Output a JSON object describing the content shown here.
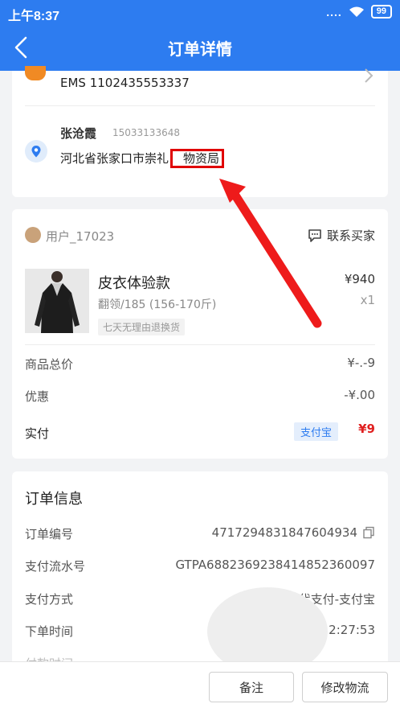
{
  "status_bar": {
    "time": "上午8:37",
    "signal": "....",
    "battery": "99"
  },
  "nav": {
    "title": "订单详情"
  },
  "shipping": {
    "carrier_line": "EMS  1102435553337",
    "receiver_name": "张沧霞",
    "receiver_phone": "15033133648",
    "address_prefix": "河北省张家口市崇礼",
    "address_highlight": "物资局"
  },
  "order_card": {
    "buyer_name": "用户_17023",
    "contact_label": "联系买家",
    "product": {
      "name": "皮衣体验款",
      "spec": "翻领/185 (156-170斤)",
      "tag": "七天无理由退换货",
      "price": "¥940",
      "qty": "x1"
    },
    "rows": [
      {
        "label": "商品总价",
        "value": "¥-.-9"
      },
      {
        "label": "优惠",
        "value": "-¥.00"
      }
    ],
    "paid_label": "实付",
    "pay_badge": "支付宝",
    "paid_value": "¥9"
  },
  "order_info": {
    "title": "订单信息",
    "rows": [
      {
        "label": "订单编号",
        "value": "4717294831847604934"
      },
      {
        "label": "支付流水号",
        "value": "GTPA6882369238414852360097"
      },
      {
        "label": "支付方式",
        "value": "代支付-支付宝"
      },
      {
        "label": "下单时间",
        "value": "2:27:53"
      },
      {
        "label": "付款时间",
        "value": ""
      }
    ]
  },
  "buttons": {
    "note": "备注",
    "modify_logistics": "修改物流"
  },
  "colors": {
    "primary": "#2d7cf0",
    "highlight_box": "#e00000",
    "arrow": "#ee1b1b",
    "ems_orange": "#f08a24"
  }
}
